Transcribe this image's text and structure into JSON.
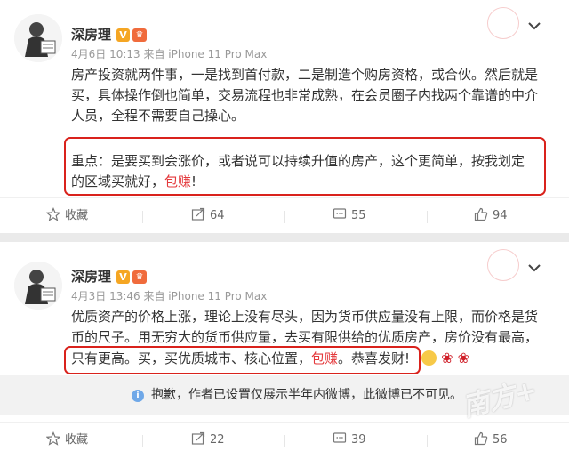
{
  "posts": [
    {
      "author": "深房理",
      "vip_badge": "V",
      "meta": "4月6日 10:13 来自 iPhone 11 Pro Max",
      "body": "房产投资就两件事，一是找到首付款，二是制造个购房资格，或合伙。然后就是买，具体操作倒也简单，交易流程也非常成熟，在会员圈子内找两个靠谱的中介人员，全程不需要自己操心。",
      "highlight_text": "重点：是要买到会涨价，或者说可以持续升值的房产，这个更简单，按我划定的区域买就好，",
      "highlight_red": "包赚",
      "highlight_tail": "!",
      "actions": {
        "favorite": "收藏",
        "repost": "64",
        "comment": "55",
        "like": "94"
      }
    },
    {
      "author": "深房理",
      "vip_badge": "V",
      "meta": "4月3日 13:46 来自 iPhone 11 Pro Max",
      "body_line1": "优质资产的价格上涨，理论上没有尽头，因为货币供应量没有上限，而价格是货",
      "body_line2": "币的尺子。用无穷大的货币供应量，去买有限供给的优质房产，房价没有最高，",
      "body_line3_a": "只有更高。买，买优质城市、核心位置，",
      "body_line3_red": "包赚",
      "body_line3_b": "。恭喜发财!",
      "notice": "抱歉，作者已设置仅展示半年内微博，此微博已不可见。",
      "actions": {
        "favorite": "收藏",
        "repost": "22",
        "comment": "39",
        "like": "56"
      }
    }
  ],
  "watermark": "南方+",
  "colors": {
    "highlight_box": "#d9221c",
    "red_text": "#e4393c",
    "badge": "#f5a623"
  }
}
